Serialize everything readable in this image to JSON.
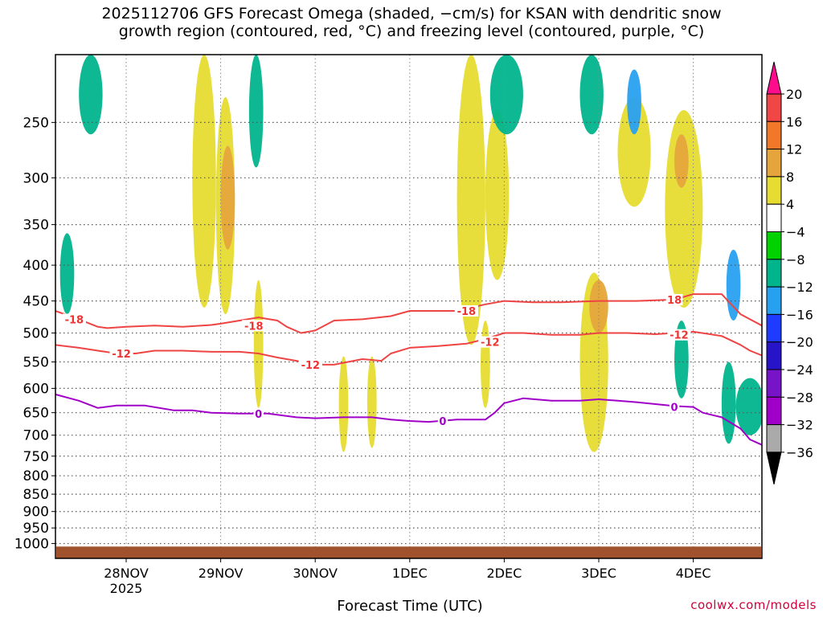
{
  "title_lines": [
    "2025112706 GFS Forecast Omega (shaded, −cm/s) for KSAN with dendritic snow",
    "growth region (contoured, red, °C) and freezing level (contoured, purple, °C)"
  ],
  "credit": "coolwx.com/models",
  "chart_data": {
    "type": "heatmap",
    "title": "2025112706 GFS Forecast Omega (shaded, −cm/s) for KSAN with dendritic snow growth region (contoured, red, °C) and freezing level (contoured, purple, °C)",
    "xlabel": "Forecast Time (UTC)",
    "ylabel": "",
    "x_range_days": [
      -0.75,
      6.75
    ],
    "x_ticks": [
      {
        "day": 0,
        "label": "28NOV",
        "sublabel": "2025"
      },
      {
        "day": 1,
        "label": "29NOV"
      },
      {
        "day": 2,
        "label": "30NOV"
      },
      {
        "day": 3,
        "label": "1DEC"
      },
      {
        "day": 4,
        "label": "2DEC"
      },
      {
        "day": 5,
        "label": "3DEC"
      },
      {
        "day": 6,
        "label": "4DEC"
      }
    ],
    "y_scale": "log-pressure",
    "y_range_hpa": [
      1050,
      200
    ],
    "y_ticks": [
      250,
      300,
      350,
      400,
      450,
      500,
      550,
      600,
      650,
      700,
      750,
      800,
      850,
      900,
      950,
      1000
    ],
    "grid": true,
    "colorbar": {
      "labels": [
        20,
        16,
        12,
        8,
        4,
        -4,
        -8,
        -12,
        -16,
        -20,
        -24,
        -28,
        -32,
        -36
      ],
      "colors": [
        "#ff0c8c",
        "#f04646",
        "#f07828",
        "#e6a53c",
        "#e6dc32",
        "#ffffff",
        "#00d200",
        "#00b48c",
        "#28a0f0",
        "#1e3cff",
        "#2814c8",
        "#7814c8",
        "#a000c8",
        "#aaaaaa",
        "#000000"
      ]
    },
    "series": [
      {
        "name": "-18",
        "color": "#ee4444",
        "x_days": [
          -0.75,
          -0.5,
          -0.3,
          -0.2,
          0.0,
          0.3,
          0.6,
          0.9,
          1.0,
          1.2,
          1.4,
          1.6,
          1.7,
          1.85,
          2.0,
          2.2,
          2.5,
          2.8,
          3.0,
          3.3,
          3.5,
          3.8,
          4.0,
          4.3,
          4.6,
          5.0,
          5.4,
          5.8,
          6.0,
          6.3,
          6.5,
          6.75
        ],
        "p_hpa": [
          465,
          478,
          490,
          492,
          490,
          488,
          490,
          487,
          485,
          480,
          475,
          480,
          490,
          500,
          496,
          480,
          478,
          473,
          465,
          465,
          465,
          455,
          450,
          452,
          452,
          450,
          450,
          448,
          440,
          440,
          470,
          490
        ]
      },
      {
        "name": "-12",
        "color": "#ee4444",
        "x_days": [
          -0.75,
          -0.5,
          -0.3,
          -0.1,
          0.1,
          0.3,
          0.6,
          0.9,
          1.0,
          1.2,
          1.4,
          1.6,
          1.8,
          2.0,
          2.2,
          2.5,
          2.7,
          2.8,
          3.0,
          3.3,
          3.6,
          3.8,
          4.0,
          4.2,
          4.5,
          4.8,
          5.0,
          5.3,
          5.6,
          5.8,
          6.0,
          6.3,
          6.5,
          6.6,
          6.75
        ],
        "p_hpa": [
          520,
          525,
          530,
          535,
          535,
          530,
          530,
          532,
          532,
          532,
          535,
          542,
          548,
          555,
          555,
          545,
          548,
          535,
          525,
          522,
          518,
          510,
          500,
          500,
          503,
          503,
          500,
          500,
          502,
          500,
          498,
          505,
          520,
          530,
          540
        ]
      },
      {
        "name": "0",
        "color": "#a000c8",
        "x_days": [
          -0.75,
          -0.5,
          -0.3,
          -0.1,
          0.2,
          0.5,
          0.7,
          0.9,
          1.2,
          1.5,
          1.8,
          2.0,
          2.3,
          2.6,
          2.8,
          3.0,
          3.2,
          3.5,
          3.8,
          3.9,
          4.0,
          4.2,
          4.5,
          4.8,
          5.0,
          5.2,
          5.4,
          5.6,
          5.8,
          6.0,
          6.1,
          6.3,
          6.5,
          6.6,
          6.75
        ],
        "p_hpa": [
          612,
          625,
          640,
          635,
          635,
          645,
          645,
          650,
          652,
          652,
          660,
          662,
          660,
          660,
          665,
          668,
          670,
          665,
          665,
          650,
          630,
          620,
          625,
          625,
          622,
          625,
          628,
          632,
          636,
          638,
          650,
          660,
          685,
          710,
          725
        ]
      }
    ],
    "contour_labels": [
      {
        "text": "-18",
        "day": -0.55,
        "p": 478
      },
      {
        "text": "-18",
        "day": 1.35,
        "p": 488
      },
      {
        "text": "-18",
        "day": 3.6,
        "p": 465
      },
      {
        "text": "18",
        "day": 5.8,
        "p": 448
      },
      {
        "text": "-12",
        "day": -0.05,
        "p": 535
      },
      {
        "text": "-12",
        "day": 1.95,
        "p": 555
      },
      {
        "text": "-12",
        "day": 3.85,
        "p": 515
      },
      {
        "text": "-12",
        "day": 5.85,
        "p": 503
      },
      {
        "text": "0",
        "day": 1.4,
        "p": 652
      },
      {
        "text": "0",
        "day": 3.35,
        "p": 668
      },
      {
        "text": "0",
        "day": 5.8,
        "p": 638
      }
    ],
    "omega_areas": [
      {
        "x": [
          0.7,
          0.95
        ],
        "p": [
          200,
          460
        ],
        "value": 4
      },
      {
        "x": [
          0.95,
          1.15
        ],
        "p": [
          230,
          470
        ],
        "value": 4
      },
      {
        "x": [
          1.0,
          1.15
        ],
        "p": [
          270,
          380
        ],
        "value": 8
      },
      {
        "x": [
          3.5,
          3.8
        ],
        "p": [
          200,
          520
        ],
        "value": 4
      },
      {
        "x": [
          3.8,
          4.05
        ],
        "p": [
          240,
          420
        ],
        "value": 4
      },
      {
        "x": [
          5.7,
          6.1
        ],
        "p": [
          240,
          460
        ],
        "value": 4
      },
      {
        "x": [
          5.8,
          5.95
        ],
        "p": [
          260,
          310
        ],
        "value": 8
      },
      {
        "x": [
          5.2,
          5.55
        ],
        "p": [
          230,
          330
        ],
        "value": 4
      },
      {
        "x": [
          4.8,
          5.1
        ],
        "p": [
          410,
          740
        ],
        "value": 4
      },
      {
        "x": [
          4.9,
          5.1
        ],
        "p": [
          420,
          500
        ],
        "value": 8
      },
      {
        "x": [
          1.35,
          1.45
        ],
        "p": [
          420,
          640
        ],
        "value": 4
      },
      {
        "x": [
          2.25,
          2.35
        ],
        "p": [
          540,
          740
        ],
        "value": 4
      },
      {
        "x": [
          2.55,
          2.65
        ],
        "p": [
          540,
          730
        ],
        "value": 4
      },
      {
        "x": [
          3.75,
          3.85
        ],
        "p": [
          480,
          640
        ],
        "value": 4
      },
      {
        "x": [
          -0.5,
          -0.25
        ],
        "p": [
          200,
          260
        ],
        "value": -8
      },
      {
        "x": [
          -0.7,
          -0.55
        ],
        "p": [
          360,
          470
        ],
        "value": -8
      },
      {
        "x": [
          1.3,
          1.45
        ],
        "p": [
          200,
          290
        ],
        "value": -8
      },
      {
        "x": [
          3.85,
          4.2
        ],
        "p": [
          200,
          260
        ],
        "value": -8
      },
      {
        "x": [
          4.8,
          5.05
        ],
        "p": [
          200,
          260
        ],
        "value": -8
      },
      {
        "x": [
          5.3,
          5.45
        ],
        "p": [
          210,
          260
        ],
        "value": -12
      },
      {
        "x": [
          6.3,
          6.45
        ],
        "p": [
          550,
          720
        ],
        "value": -8
      },
      {
        "x": [
          6.45,
          6.75
        ],
        "p": [
          580,
          700
        ],
        "value": -8
      },
      {
        "x": [
          6.35,
          6.5
        ],
        "p": [
          380,
          480
        ],
        "value": -12
      },
      {
        "x": [
          5.8,
          5.95
        ],
        "p": [
          480,
          620
        ],
        "value": -8
      }
    ]
  }
}
